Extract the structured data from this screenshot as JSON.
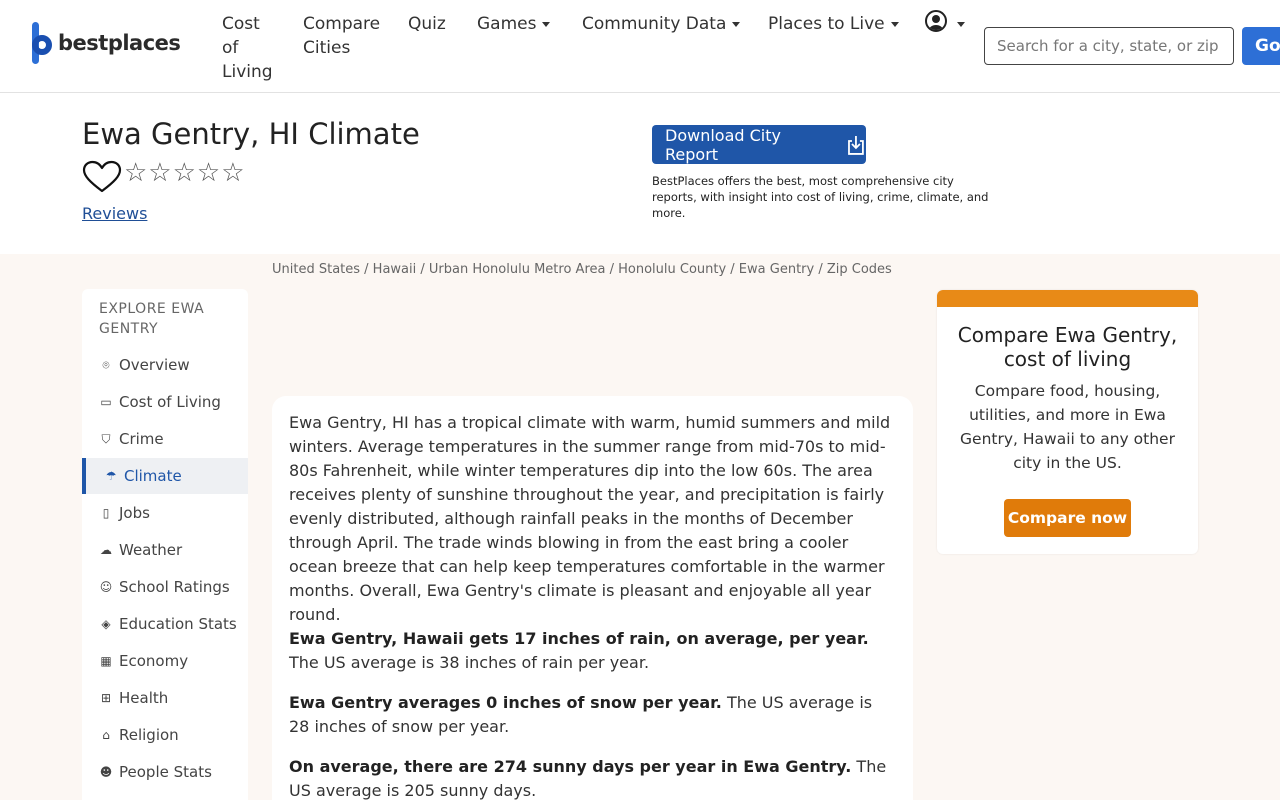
{
  "header": {
    "logo_text": "bestplaces",
    "nav": {
      "cost_of_living": [
        "Cost",
        "of",
        "Living"
      ],
      "compare_cities": [
        "Compare",
        "Cities"
      ],
      "quiz": "Quiz",
      "games": "Games",
      "community_data": "Community Data",
      "places_to_live": "Places to Live"
    },
    "search_placeholder": "Search for a city, state, or zip",
    "go_label": "Go"
  },
  "title": {
    "heading": "Ewa Gentry, HI Climate",
    "stars": "☆☆☆☆☆",
    "reviews": "Reviews",
    "download_label": "Download City Report",
    "download_note": "BestPlaces offers the best, most comprehensive city reports, with insight into cost of living, crime, climate, and more."
  },
  "breadcrumb": "United States / Hawaii / Urban Honolulu Metro Area / Honolulu County / Ewa Gentry / Zip Codes",
  "sidebar": {
    "heading": "EXPLORE EWA GENTRY",
    "items": [
      {
        "label": "Overview",
        "icon": "map-pin-icon"
      },
      {
        "label": "Cost of Living",
        "icon": "wallet-icon"
      },
      {
        "label": "Crime",
        "icon": "shield-icon"
      },
      {
        "label": "Climate",
        "icon": "umbrella-icon"
      },
      {
        "label": "Jobs",
        "icon": "clipboard-icon"
      },
      {
        "label": "Weather",
        "icon": "cloud-rain-icon"
      },
      {
        "label": "School Ratings",
        "icon": "school-icon"
      },
      {
        "label": "Education Stats",
        "icon": "graduation-cap-icon"
      },
      {
        "label": "Economy",
        "icon": "bank-icon"
      },
      {
        "label": "Health",
        "icon": "first-aid-icon"
      },
      {
        "label": "Religion",
        "icon": "church-icon"
      },
      {
        "label": "People Stats",
        "icon": "people-icon"
      }
    ]
  },
  "content": {
    "intro": "Ewa Gentry, HI has a tropical climate with warm, humid summers and mild winters. Average temperatures in the summer range from mid-70s to mid-80s Fahrenheit, while winter temperatures dip into the low 60s. The area receives plenty of sunshine throughout the year, and precipitation is fairly evenly distributed, although rainfall peaks in the months of December through April. The trade winds blowing in from the east bring a cooler ocean breeze that can help keep temperatures comfortable in the warmer months. Overall, Ewa Gentry's climate is pleasant and enjoyable all year round.",
    "rain_bold": "Ewa Gentry, Hawaii gets 17 inches of rain, on average, per year.",
    "rain_rest": " The US average is 38 inches of rain per year.",
    "snow_bold": "Ewa Gentry averages 0 inches of snow per year.",
    "snow_rest": " The US average is 28 inches of snow per year.",
    "sun_bold": "On average, there are 274 sunny days per year in Ewa Gentry.",
    "sun_rest": " The US average is 205 sunny days."
  },
  "compare": {
    "title": "Compare Ewa Gentry, cost of living",
    "description": "Compare food, housing, utilities, and more in Ewa Gentry, Hawaii to any other city in the US.",
    "button": "Compare now"
  },
  "colors": {
    "primary_blue": "#1f56a8",
    "accent_orange": "#e07b0a",
    "page_bg": "#fcf7f3"
  }
}
